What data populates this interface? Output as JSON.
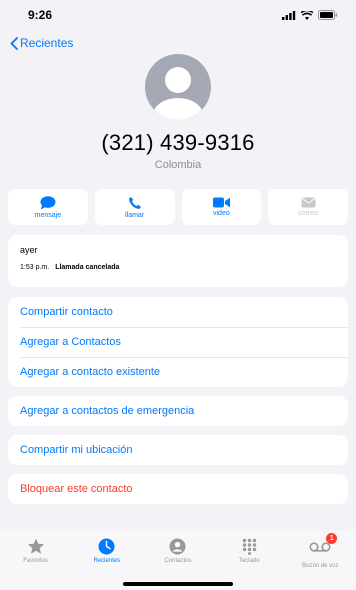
{
  "status": {
    "time": "9:26"
  },
  "nav": {
    "back_label": "Recientes"
  },
  "contact": {
    "number": "(321) 439-9316",
    "country": "Colombia"
  },
  "actions": [
    {
      "label": "mensaje",
      "icon": "message-icon"
    },
    {
      "label": "llamar",
      "icon": "phone-icon"
    },
    {
      "label": "video",
      "icon": "video-icon"
    },
    {
      "label": "correo",
      "icon": "mail-icon",
      "disabled": true
    }
  ],
  "history": {
    "day": "ayer",
    "time": "1:53 p.m.",
    "status": "Llamada cancelada"
  },
  "options": [
    "Compartir contacto",
    "Agregar a Contactos",
    "Agregar a contacto existente"
  ],
  "emergency": "Agregar a contactos de emergencia",
  "share_location": "Compartir mi ubicación",
  "block": "Bloquear este contacto",
  "tabs": [
    {
      "label": "Favoritos",
      "icon": "star-icon"
    },
    {
      "label": "Recientes",
      "icon": "clock-icon",
      "active": true
    },
    {
      "label": "Contactos",
      "icon": "contacts-icon"
    },
    {
      "label": "Teclado",
      "icon": "keypad-icon"
    },
    {
      "label": "Buzón de voz",
      "icon": "voicemail-icon",
      "badge": "1"
    }
  ],
  "colors": {
    "accent": "#007aff",
    "danger": "#ff3b30",
    "background": "#f2f2f7"
  }
}
